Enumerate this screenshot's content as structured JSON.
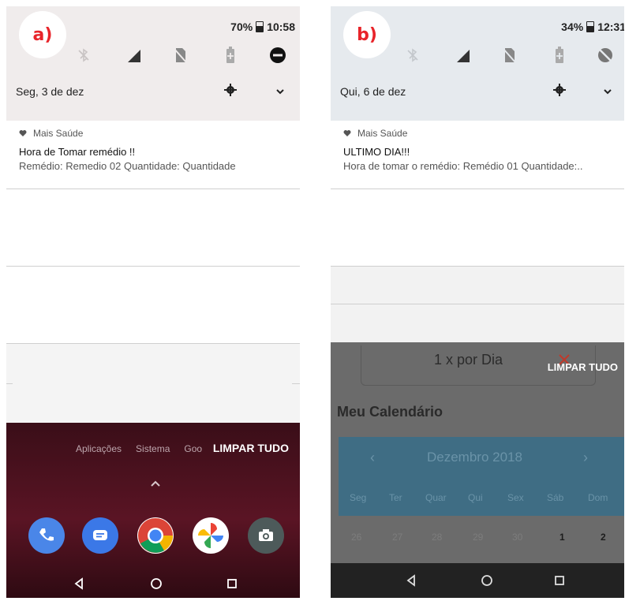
{
  "panels": [
    {
      "label": "a)",
      "status": {
        "battery": "70%",
        "time": "10:58"
      },
      "date": "Seg, 3 de dez",
      "notification": {
        "app": "Mais Saúde",
        "title": "Hora de Tomar remédio !!",
        "text": "Remédio: Remedio 02   Quantidade: Quantidade"
      },
      "home": {
        "app_labels": [
          "Aplicações",
          "Sistema",
          "Goo"
        ],
        "clear_all": "LIMPAR TUDO"
      }
    },
    {
      "label": "b)",
      "status": {
        "battery": "34%",
        "time": "12:31"
      },
      "date": "Qui, 6 de dez",
      "notification": {
        "app": "Mais Saúde",
        "title": "ULTIMO DIA!!!",
        "text": "Hora de tomar o remédio: Remédio 01   Quantidade:.."
      },
      "background_app": {
        "dose": "1 x por Dia",
        "clear_all": "LIMPAR TUDO",
        "calendar_title": "Meu Calendário",
        "month": "Dezembro  2018",
        "weekdays": [
          "Seg",
          "Ter",
          "Quar",
          "Qui",
          "Sex",
          "Sáb",
          "Dom"
        ],
        "days": [
          "26",
          "27",
          "28",
          "29",
          "30",
          "1",
          "2"
        ]
      }
    }
  ],
  "colors": {
    "badge_text": "#e8242a",
    "calendar_header": "#3f6d84",
    "home_bg": "#4a1020"
  }
}
